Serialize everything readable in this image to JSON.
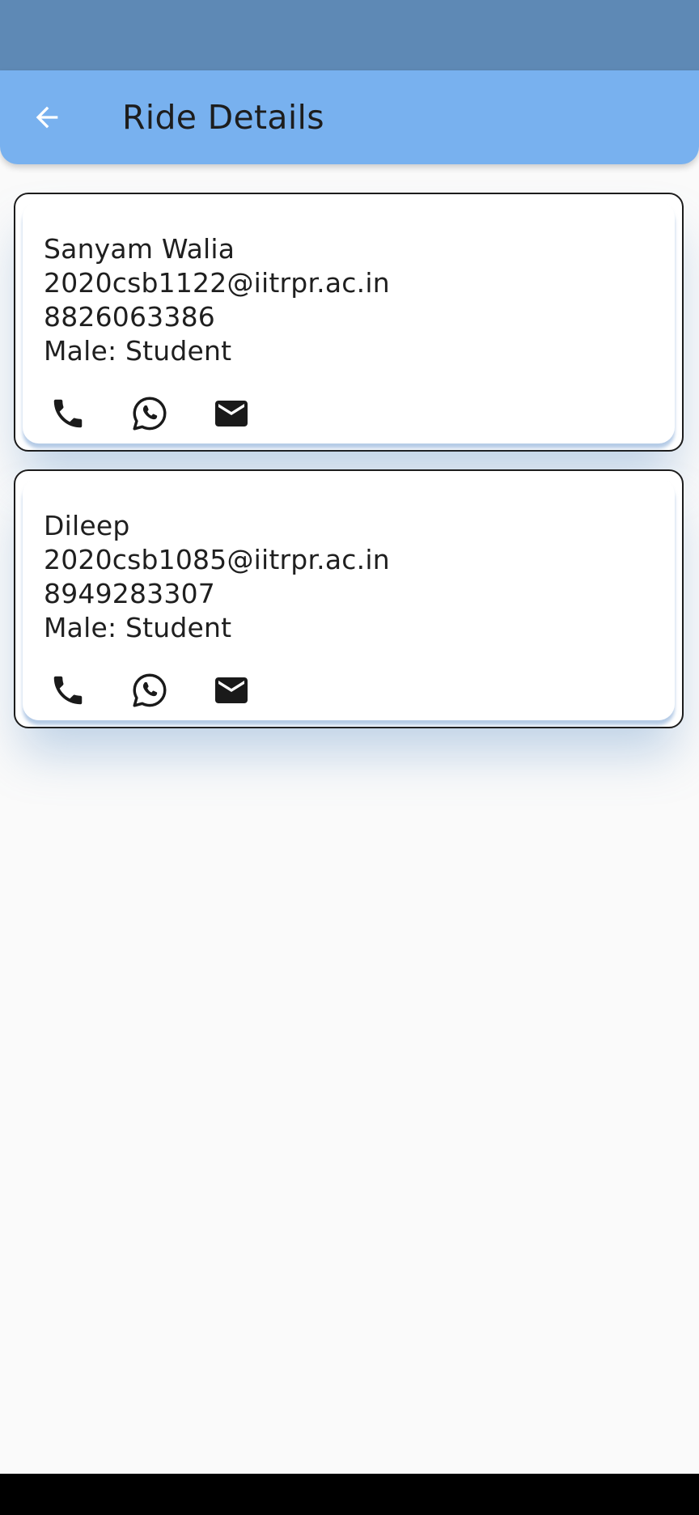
{
  "app_bar": {
    "title": "Ride Details",
    "back_icon": "arrow-back-icon"
  },
  "riders": [
    {
      "name": "Sanyam Walia",
      "email": "2020csb1122@iitrpr.ac.in",
      "phone": "8826063386",
      "info": "Male: Student",
      "actions": [
        "phone-icon",
        "whatsapp-icon",
        "email-icon"
      ]
    },
    {
      "name": "Dileep",
      "email": "2020csb1085@iitrpr.ac.in",
      "phone": "8949283307",
      "info": "Male: Student",
      "actions": [
        "phone-icon",
        "whatsapp-icon",
        "email-icon"
      ]
    }
  ],
  "colors": {
    "status_bar": "#5e89b5",
    "app_bar": "#78b1ef",
    "background": "#fafafa",
    "card_border": "#1c1c1c"
  }
}
